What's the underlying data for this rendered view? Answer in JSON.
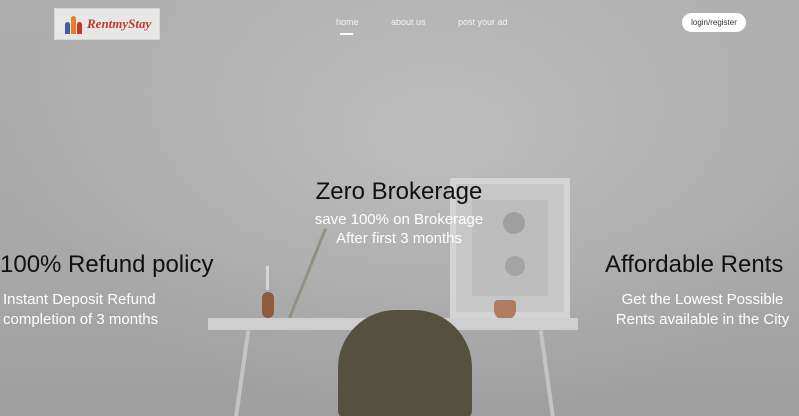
{
  "brand": {
    "logo_text": "RentmyStay"
  },
  "nav": {
    "links": [
      "home",
      "about us",
      "post your ad"
    ],
    "active": "home",
    "login_label": "login/register"
  },
  "features": {
    "center": {
      "title": "Zero Brokerage",
      "line1": "save 100% on Brokerage",
      "line2": "After first 3 months"
    },
    "left": {
      "title": "100% Refund policy",
      "line1": "Instant Deposit Refund",
      "line2": "completion of 3 months"
    },
    "right": {
      "title": "Affordable Rents",
      "line1": "Get the Lowest Possible",
      "line2": "Rents available in the City"
    }
  },
  "colors": {
    "overlay": "#b4b4b4",
    "title_text": "#111111",
    "sub_text": "#ffffff",
    "logo_red": "#c0392b"
  }
}
